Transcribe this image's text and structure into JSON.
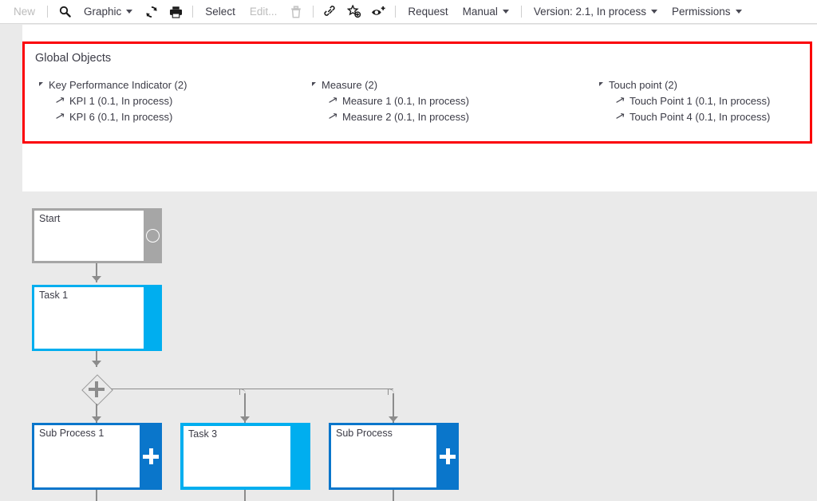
{
  "toolbar": {
    "items": [
      {
        "type": "text",
        "label": "New",
        "name": "toolbar-new",
        "disabled": true
      },
      {
        "type": "sep"
      },
      {
        "type": "icon",
        "label": "search-icon",
        "name": "toolbar-search-icon"
      },
      {
        "type": "text",
        "label": "Graphic",
        "name": "toolbar-graphic",
        "caret": true
      },
      {
        "type": "icon",
        "label": "refresh-icon",
        "name": "toolbar-refresh-icon"
      },
      {
        "type": "icon",
        "label": "print-icon",
        "name": "toolbar-print-icon"
      },
      {
        "type": "sep"
      },
      {
        "type": "text",
        "label": "Select",
        "name": "toolbar-select"
      },
      {
        "type": "text",
        "label": "Edit...",
        "name": "toolbar-edit",
        "disabled": true
      },
      {
        "type": "icon",
        "label": "trash-icon",
        "name": "toolbar-delete-icon",
        "disabled": true
      },
      {
        "type": "sep"
      },
      {
        "type": "icon",
        "label": "link-icon",
        "name": "toolbar-link-icon"
      },
      {
        "type": "icon",
        "label": "star-add-icon",
        "name": "toolbar-favorite-add-icon"
      },
      {
        "type": "icon",
        "label": "eye-add-icon",
        "name": "toolbar-subscribe-icon"
      },
      {
        "type": "sep"
      },
      {
        "type": "text",
        "label": "Request",
        "name": "toolbar-request"
      },
      {
        "type": "text",
        "label": "Manual",
        "name": "toolbar-manual",
        "caret": true
      },
      {
        "type": "sep"
      },
      {
        "type": "text",
        "label": "Version: 2.1, In process",
        "name": "toolbar-version",
        "caret": true
      },
      {
        "type": "text",
        "label": "Permissions",
        "name": "toolbar-permissions",
        "caret": true
      }
    ]
  },
  "global_objects": {
    "title": "Global Objects",
    "highlight_color": "#fb0007",
    "groups": [
      {
        "label": "Key Performance Indicator (2)",
        "items": [
          "KPI 1 (0.1, In process)",
          "KPI 6 (0.1, In process)"
        ]
      },
      {
        "label": "Measure (2)",
        "items": [
          "Measure 1 (0.1, In process)",
          "Measure 2 (0.1, In process)"
        ]
      },
      {
        "label": "Touch point (2)",
        "items": [
          "Touch Point 1 (0.1, In process)",
          "Touch Point 4 (0.1, In process)"
        ]
      }
    ]
  },
  "diagram": {
    "colors": {
      "canvas": "#eaeaea",
      "start": "#a6a6a6",
      "task": "#00aeef",
      "subprocess": "#0a76cb",
      "connector": "#8c8c8c"
    },
    "nodes": [
      {
        "name": "start-node",
        "label": "Start",
        "kind": "start"
      },
      {
        "name": "task-1-node",
        "label": "Task 1",
        "kind": "task"
      },
      {
        "name": "sub-process-1-node",
        "label": "Sub Process 1",
        "kind": "subprocess"
      },
      {
        "name": "task-3-node",
        "label": "Task 3",
        "kind": "task"
      },
      {
        "name": "sub-process-node",
        "label": "Sub Process",
        "kind": "subprocess"
      }
    ],
    "gateway": {
      "name": "parallel-gateway",
      "symbol": "+"
    }
  }
}
